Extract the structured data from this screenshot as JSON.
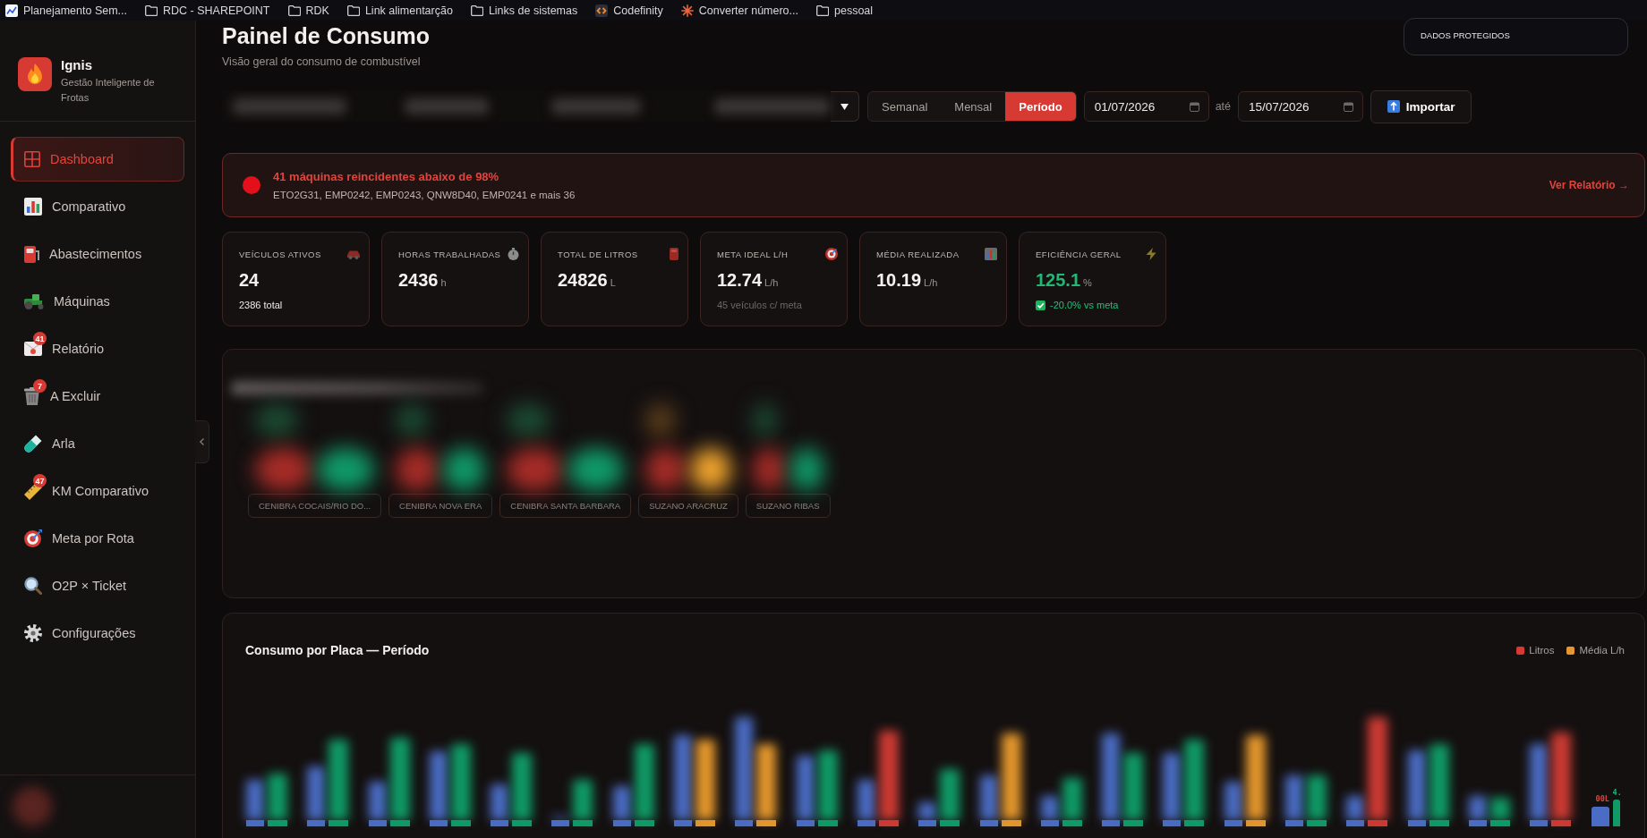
{
  "bookmarks": [
    {
      "kind": "site",
      "label": "Planejamento Sem..."
    },
    {
      "kind": "folder",
      "label": "RDC - SHAREPOINT"
    },
    {
      "kind": "folder",
      "label": "RDK"
    },
    {
      "kind": "folder",
      "label": "Link alimentarção"
    },
    {
      "kind": "folder",
      "label": "Links de sistemas"
    },
    {
      "kind": "code",
      "label": "Codefinity"
    },
    {
      "kind": "sparkle",
      "label": "Converter número..."
    },
    {
      "kind": "folder",
      "label": "pessoal"
    }
  ],
  "sidebar": {
    "brand": {
      "name": "Ignis",
      "tagline": "Gestão Inteligente de Frotas"
    },
    "items": [
      {
        "label": "Dashboard",
        "selected": true
      },
      {
        "label": "Comparativo",
        "selected": false
      },
      {
        "label": "Abastecimentos",
        "selected": false
      },
      {
        "label": "Máquinas",
        "selected": false
      },
      {
        "label": "Relatório",
        "selected": false,
        "badge": "41"
      },
      {
        "label": "A Excluir",
        "selected": false,
        "badge": "7"
      },
      {
        "label": "Arla",
        "selected": false
      },
      {
        "label": "KM Comparativo",
        "selected": false,
        "badge": "47"
      },
      {
        "label": "Meta por Rota",
        "selected": false
      },
      {
        "label": "O2P × Ticket",
        "selected": false
      },
      {
        "label": "Configurações",
        "selected": false
      }
    ]
  },
  "privacy_badge": "DADOS PROTEGIDOS",
  "header": {
    "title": "Painel de Consumo",
    "subtitle": "Visão geral do consumo de combustível"
  },
  "filters": {
    "periods": [
      {
        "label": "Semanal",
        "selected": false
      },
      {
        "label": "Mensal",
        "selected": false
      },
      {
        "label": "Período",
        "selected": true
      }
    ],
    "date_from": "01/07/2026",
    "date_separator": "até",
    "date_to": "15/07/2026",
    "import_button": "Importar"
  },
  "alert": {
    "title": "41 máquinas reincidentes abaixo de 98%",
    "detail": "ETO2G31, EMP0242, EMP0243, QNW8D40, EMP0241 e mais 36",
    "link": "Ver Relatório →"
  },
  "stats": [
    {
      "label": "VEÍCULOS ATIVOS",
      "value": "24",
      "highlighted": false,
      "note": {
        "text": "2386 total",
        "kind": "plain"
      }
    },
    {
      "label": "HORAS TRABALHADAS",
      "value": "2436",
      "unit": "h",
      "highlighted": false
    },
    {
      "label": "TOTAL DE LITROS",
      "value": "24826",
      "unit": "L",
      "highlighted": false
    },
    {
      "label": "META IDEAL L/H",
      "value": "12.74",
      "unit": "L/h",
      "highlighted": false,
      "note": {
        "text": "45 veículos c/ meta",
        "kind": "muted"
      }
    },
    {
      "label": "MÉDIA REALIZADA",
      "value": "10.19",
      "unit": "L/h",
      "highlighted": false
    },
    {
      "label": "EFICIÊNCIA GERAL",
      "value": "125.1",
      "unit": "%",
      "highlighted": true,
      "note": {
        "text": "-20.0% vs meta",
        "kind": "positive"
      }
    }
  ],
  "routes": [
    {
      "label": "CENIBRA COCAIS/RIO DO...",
      "warning": false
    },
    {
      "label": "CENIBRA NOVA ERA",
      "warning": false
    },
    {
      "label": "CENIBRA SANTA BARBARA",
      "warning": false
    },
    {
      "label": "SUZANO ARACRUZ",
      "warning": true
    },
    {
      "label": "SUZANO RIBAS",
      "warning": false
    }
  ],
  "chart": {
    "title": "Consumo por Placa — Período",
    "legend": [
      {
        "label": "Litros",
        "color": "#d63a33"
      },
      {
        "label": "Média L/h",
        "color": "#e8962e"
      }
    ],
    "end_labels": [
      "00L",
      "4."
    ]
  }
}
